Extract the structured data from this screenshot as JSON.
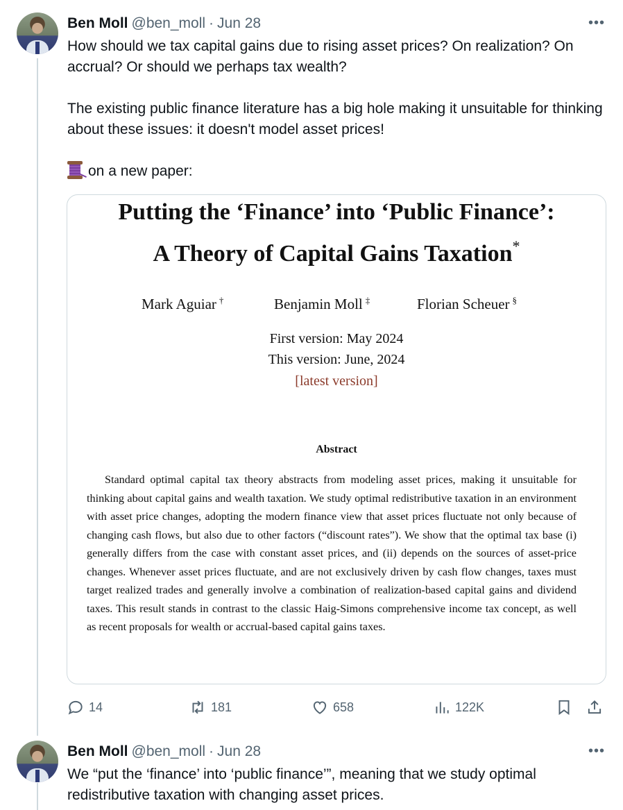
{
  "tweets": [
    {
      "author_name": "Ben Moll",
      "handle": "@ben_moll",
      "separator": "·",
      "date": "Jun 28",
      "more_label": "•••",
      "paragraph_1": "How should we tax capital gains due to rising asset prices? On realization? On accrual? Or should we perhaps tax wealth?",
      "paragraph_2": "The existing public finance literature has a big hole making it unsuitable for thinking about these issues: it doesn't model asset prices!",
      "paragraph_3": "on a new paper:",
      "emoji_icon": "thread-spool-icon",
      "paper": {
        "title_line_1": "Putting the ‘Finance’ into ‘Public Finance’:",
        "title_line_2": "A Theory of Capital Gains Taxation",
        "title_mark": "*",
        "authors": [
          {
            "name": "Mark Aguiar",
            "mark": "†"
          },
          {
            "name": "Benjamin Moll",
            "mark": "‡"
          },
          {
            "name": "Florian Scheuer",
            "mark": "§"
          }
        ],
        "first_version": "First version: May 2024",
        "this_version": "This version: June, 2024",
        "latest_link": "[latest version]",
        "abstract_heading": "Abstract",
        "abstract_text": "Standard optimal capital tax theory abstracts from modeling asset prices, making it unsuitable for thinking about capital gains and wealth taxation. We study optimal redistributive taxation in an environment with asset price changes, adopting the modern finance view that asset prices fluctuate not only because of changing cash flows, but also due to other factors (“discount rates”). We show that the optimal tax base (i) generally differs from the case with constant asset prices, and (ii) depends on the sources of asset-price changes. Whenever asset prices fluctuate, and are not exclusively driven by cash flow changes, taxes must target realized trades and generally involve a combination of realization-based capital gains and dividend taxes. This result stands in contrast to the classic Haig-Simons comprehensive income tax concept, as well as recent proposals for wealth or accrual-based capital gains taxes."
      },
      "actions": {
        "replies": "14",
        "reposts": "181",
        "likes": "658",
        "views": "122K"
      }
    },
    {
      "author_name": "Ben Moll",
      "handle": "@ben_moll",
      "separator": "·",
      "date": "Jun 28",
      "more_label": "•••",
      "text": "We “put the ‘finance’ into ‘public finance’”, meaning that we study optimal redistributive taxation with changing asset prices."
    }
  ],
  "colors": {
    "text": "#0f1419",
    "secondary": "#536471",
    "border": "#cfd9de",
    "link_red": "#8b3a2a"
  }
}
